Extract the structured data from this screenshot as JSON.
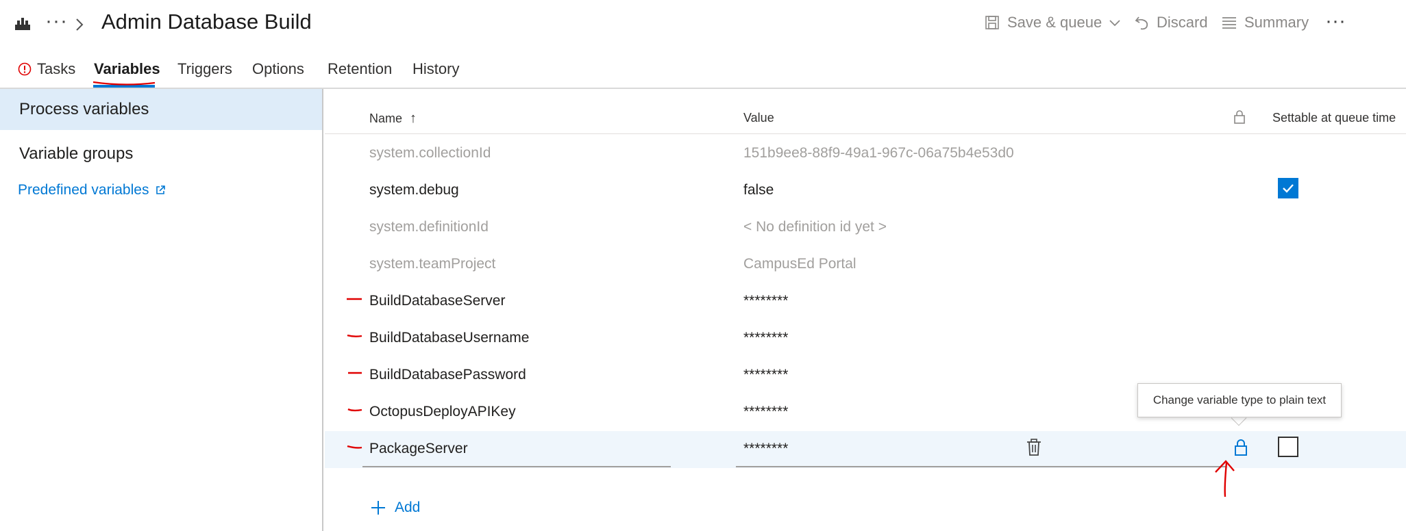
{
  "header": {
    "brand_icon": "pipeline-build-icon",
    "breadcrumb_more": "···",
    "title": "Admin Database Build",
    "toolbar": {
      "save_queue": "Save & queue",
      "discard": "Discard",
      "summary": "Summary",
      "more": "···"
    }
  },
  "tabs": [
    {
      "label": "Tasks",
      "icon": "error-icon",
      "active": false
    },
    {
      "label": "Variables",
      "active": true
    },
    {
      "label": "Triggers",
      "active": false
    },
    {
      "label": "Options",
      "active": false
    },
    {
      "label": "Retention",
      "active": false
    },
    {
      "label": "History",
      "active": false
    }
  ],
  "left_pane": {
    "process_variables": "Process variables",
    "variable_groups": "Variable groups",
    "predefined_variables": "Predefined variables"
  },
  "grid": {
    "headers": {
      "name": "Name",
      "sort": "↑",
      "value": "Value",
      "settable": "Settable at queue time"
    },
    "rows": [
      {
        "name": "system.collectionId",
        "value": "151b9ee8-88f9-49a1-967c-06a75b4e53d0",
        "readonly": true
      },
      {
        "name": "system.debug",
        "value": "false",
        "settable": true
      },
      {
        "name": "system.definitionId",
        "value": "< No definition id yet >",
        "readonly": true
      },
      {
        "name": "system.teamProject",
        "value": "CampusEd Portal",
        "readonly": true
      },
      {
        "name": "BuildDatabaseServer",
        "value": "********"
      },
      {
        "name": "BuildDatabaseUsername",
        "value": "********"
      },
      {
        "name": "BuildDatabasePassword",
        "value": "********"
      },
      {
        "name": "OctopusDeployAPIKey",
        "value": "********"
      },
      {
        "name": "PackageServer",
        "value": "********",
        "settable": false
      }
    ]
  },
  "tooltip": "Change variable type to plain text",
  "add_label": "Add",
  "colors": {
    "accent": "#0078d4",
    "selected_bg": "#deecf9",
    "annotation": "#e00000"
  }
}
